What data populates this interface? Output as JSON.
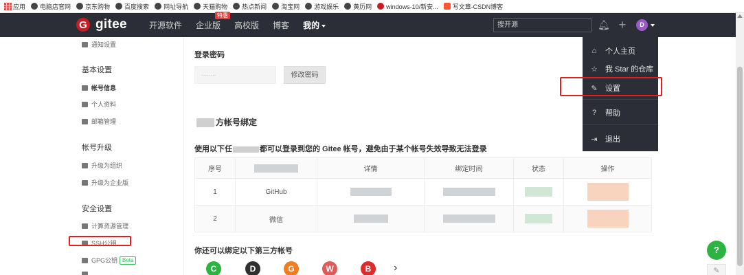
{
  "bookmarks": [
    {
      "label": "应用",
      "icon": "apps-icon"
    },
    {
      "label": "电脑店官网",
      "icon": "globe-icon"
    },
    {
      "label": "京东购物",
      "icon": "globe-icon"
    },
    {
      "label": "百度搜索",
      "icon": "globe-icon"
    },
    {
      "label": "网址导航",
      "icon": "globe-icon"
    },
    {
      "label": "天猫购物",
      "icon": "globe-icon"
    },
    {
      "label": "热点新闻",
      "icon": "globe-icon"
    },
    {
      "label": "淘宝网",
      "icon": "globe-icon"
    },
    {
      "label": "游戏娱乐",
      "icon": "globe-icon"
    },
    {
      "label": "黄历网",
      "icon": "globe-icon"
    },
    {
      "label": "windows-10/新安...",
      "icon": "gitee-icon"
    },
    {
      "label": "写文章-CSDN博客",
      "icon": "csdn-icon"
    }
  ],
  "nav": {
    "logo_mark": "G",
    "logo": "gitee",
    "links": [
      "开源软件",
      "企业版",
      "高校版",
      "博客",
      "我的"
    ],
    "enterprise_badge": "特惠",
    "search_placeholder": "搜开源",
    "avatar_initial": "D"
  },
  "sidebar": {
    "notify": "通知设置",
    "basic_head": "基本设置",
    "account_info": "帐号信息",
    "profile": "个人资料",
    "email": "邮箱管理",
    "upgrade_head": "帐号升级",
    "to_org": "升级为组织",
    "to_enterprise": "升级为企业版",
    "security_head": "安全设置",
    "compute": "计算资源管理",
    "ssh": "SSH公钥",
    "gpg": "GPG公钥",
    "beta": "Beta"
  },
  "main": {
    "pwd_label": "登录密码",
    "pwd_mask": "········",
    "pwd_button": "修改密码",
    "section_title": "方帐号绑定",
    "desc_prefix": "使用以下任",
    "desc_suffix": "都可以登录到您的 Gitee 帐号，避免由于某个帐号失效导致无法登录",
    "table_headers": [
      "序号",
      "",
      "详情",
      "绑定时间",
      "状态",
      "操作"
    ],
    "rows": [
      {
        "no": "1",
        "platform": "GitHub"
      },
      {
        "no": "2",
        "platform": "微信"
      }
    ],
    "more_label": "你还可以绑定以下第三方帐号",
    "more_arrow": "›"
  },
  "brands": [
    {
      "glyph": "C",
      "color": "#2db342"
    },
    {
      "glyph": "D",
      "color": "#303030"
    },
    {
      "glyph": "G",
      "color": "#f07d22"
    },
    {
      "glyph": "W",
      "color": "#e15a5a"
    },
    {
      "glyph": "B",
      "color": "#e02b2b"
    }
  ],
  "dropdown": [
    {
      "icon": "home-icon",
      "glyph": "⌂",
      "label": "个人主页"
    },
    {
      "icon": "star-icon",
      "glyph": "☆",
      "label": "我 Star 的仓库"
    },
    {
      "icon": "settings-icon",
      "glyph": "✎",
      "label": "设置"
    },
    {
      "icon": "help-icon",
      "glyph": "?",
      "label": "帮助"
    },
    {
      "icon": "logout-icon",
      "glyph": "⇥",
      "label": "退出"
    }
  ],
  "fab": {
    "help": "?",
    "edit": "✎"
  },
  "colors": {
    "nav_bg": "#2b2e36",
    "accent_red": "#c71d23",
    "highlight_red": "#e02020",
    "green": "#2db342"
  }
}
